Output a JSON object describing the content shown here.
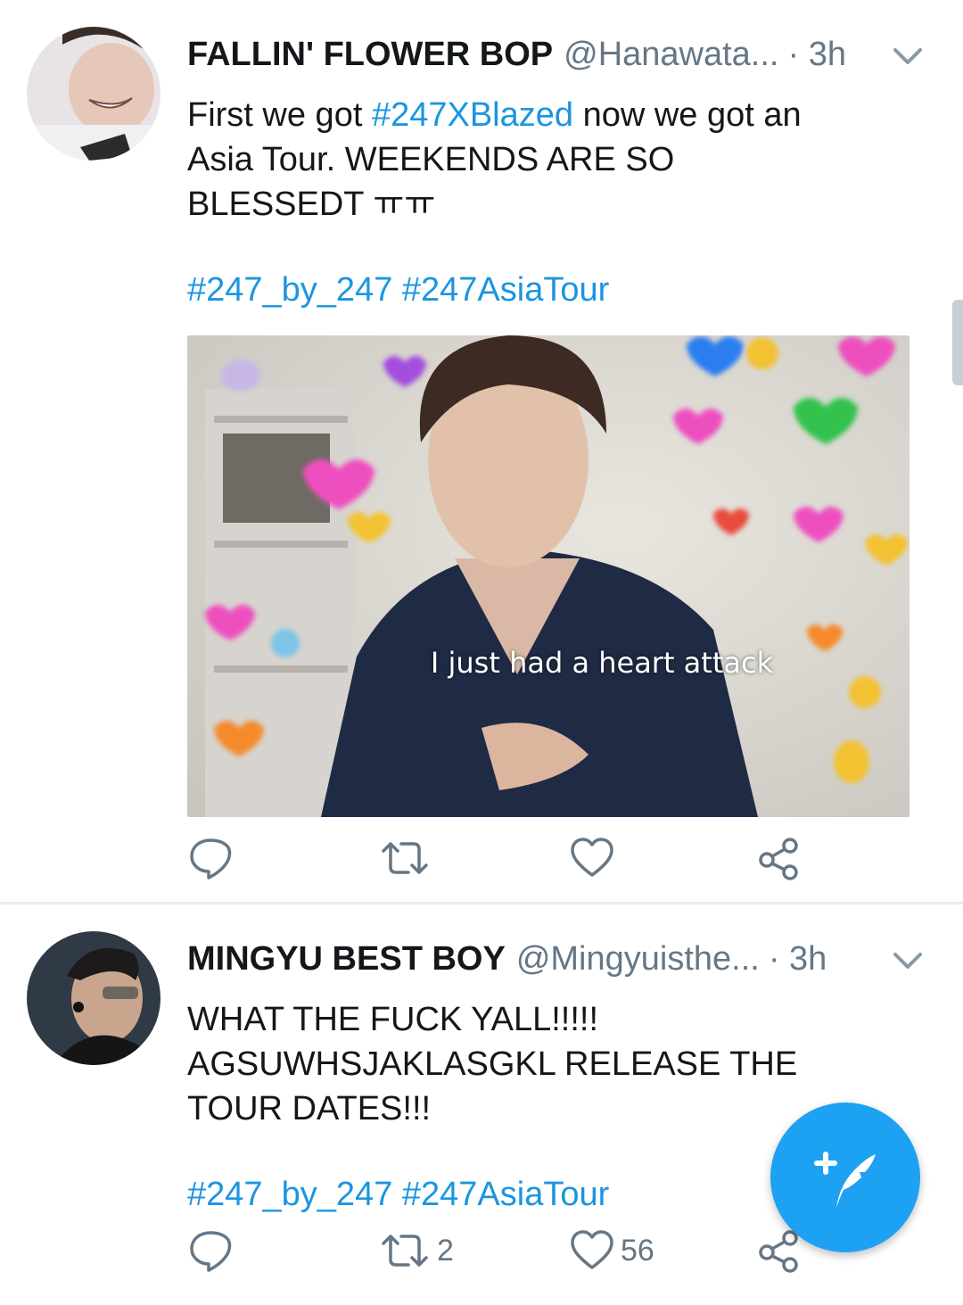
{
  "tweets": [
    {
      "display_name": "FALLIN' FLOWER BOP",
      "handle": "@Hanawata...",
      "time": "· 3h",
      "text_before": "First we got ",
      "text_hashtag": "#247XBlazed",
      "text_after": " now we got an Asia Tour. WEEKENDS ARE SO BLESSEDT ㅠㅠ",
      "hashtags": "#247_by_247 #247AsiaTour",
      "media_caption": "I just had a heart attack",
      "reply_count": "",
      "retweet_count": "",
      "like_count": ""
    },
    {
      "display_name": "MINGYU BEST BOY",
      "handle": "@Mingyuisthe...",
      "time": "· 3h",
      "text": "WHAT THE FUCK YALL!!!!! AGSUWHSJAKLASGKL RELEASE THE TOUR DATES!!!",
      "hashtags": "#247_by_247 #247AsiaTour",
      "reply_count": "",
      "retweet_count": "2",
      "like_count": "56"
    }
  ],
  "colors": {
    "accent": "#1da1f2",
    "hashtag": "#1b95e0",
    "secondary_text": "#657786",
    "divider": "#e6ecf0"
  },
  "icons": [
    "reply-icon",
    "retweet-icon",
    "like-icon",
    "share-icon",
    "chevron-down-icon",
    "compose-tweet-icon"
  ]
}
